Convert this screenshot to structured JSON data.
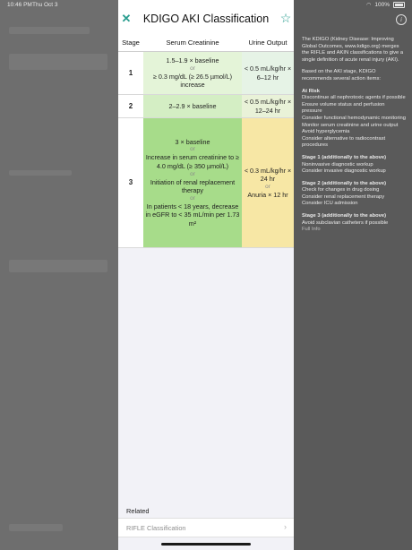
{
  "status_bar": {
    "time": "10:46 PM",
    "day": "Thu Oct 3",
    "battery": "100%"
  },
  "sheet": {
    "title": "KDIGO AKI Classification",
    "close_icon": "✕",
    "star_icon": "☆",
    "table": {
      "headers": [
        "Stage",
        "Serum Creatinine",
        "Urine Output"
      ],
      "or_label": "or",
      "rows": [
        {
          "stage": "1",
          "creatinine": [
            "1.5–1.9 × baseline",
            "≥ 0.3 mg/dL (≥ 26.5 µmol/L) increase"
          ],
          "urine": [
            "< 0.5 mL/kg/hr × 6–12 hr"
          ]
        },
        {
          "stage": "2",
          "creatinine": [
            "2–2.9 × baseline"
          ],
          "urine": [
            "< 0.5 mL/kg/hr × 12–24 hr"
          ]
        },
        {
          "stage": "3",
          "creatinine": [
            "3 × baseline",
            "Increase in serum creatinine to ≥ 4.0 mg/dL (≥ 350 µmol/L)",
            "Initiation of renal replacement therapy",
            "In patients < 18 years, decrease in eGFR to < 35 mL/min per 1.73 m²"
          ],
          "urine": [
            "< 0.3 mL/kg/hr × 24 hr",
            "Anuria × 12 hr"
          ]
        }
      ]
    },
    "related": {
      "label": "Related",
      "item": "RIFLE Classification",
      "chevron": "›"
    }
  },
  "info_panel": {
    "icon": "i",
    "intro": "The KDIGO (Kidney Disease: Improving Global Outcomes, www.kdigo.org) merges the RIFLE and AKIN classifications to give a single definition of acute renal injury (AKI).",
    "based_on": "Based on the AKI stage, KDIGO recommends several action items:",
    "sections": [
      {
        "title": "At Risk",
        "items": [
          "Discontinue all nephrotoxic agents if possible",
          "Ensure volume status and perfusion pressure",
          "Consider functional hemodynamic monitoring",
          "Monitor serum creatinine and urine output",
          "Avoid hyperglycemia",
          "Consider alternative to radiocontrast procedures"
        ]
      },
      {
        "title": "Stage 1 (additionally to the above)",
        "items": [
          "Noninvasive diagnostic workup",
          "Consider invasive diagnostic workup"
        ]
      },
      {
        "title": "Stage 2 (additionally to the above)",
        "items": [
          "Check for changes in drug dosing",
          "Consider renal replacement therapy",
          "Consider ICU admission"
        ]
      },
      {
        "title": "Stage 3 (additionally to the above)",
        "items": [
          "Avoid subclavian catheters if possible"
        ]
      }
    ],
    "link": "Full Info"
  },
  "colors": {
    "accent": "#2a9d8f",
    "stage1_sc": "#e4f4d8",
    "stage2_sc": "#d4eec4",
    "stage3_sc": "#a7dc8a",
    "stage3_uo": "#f7e7a5"
  }
}
